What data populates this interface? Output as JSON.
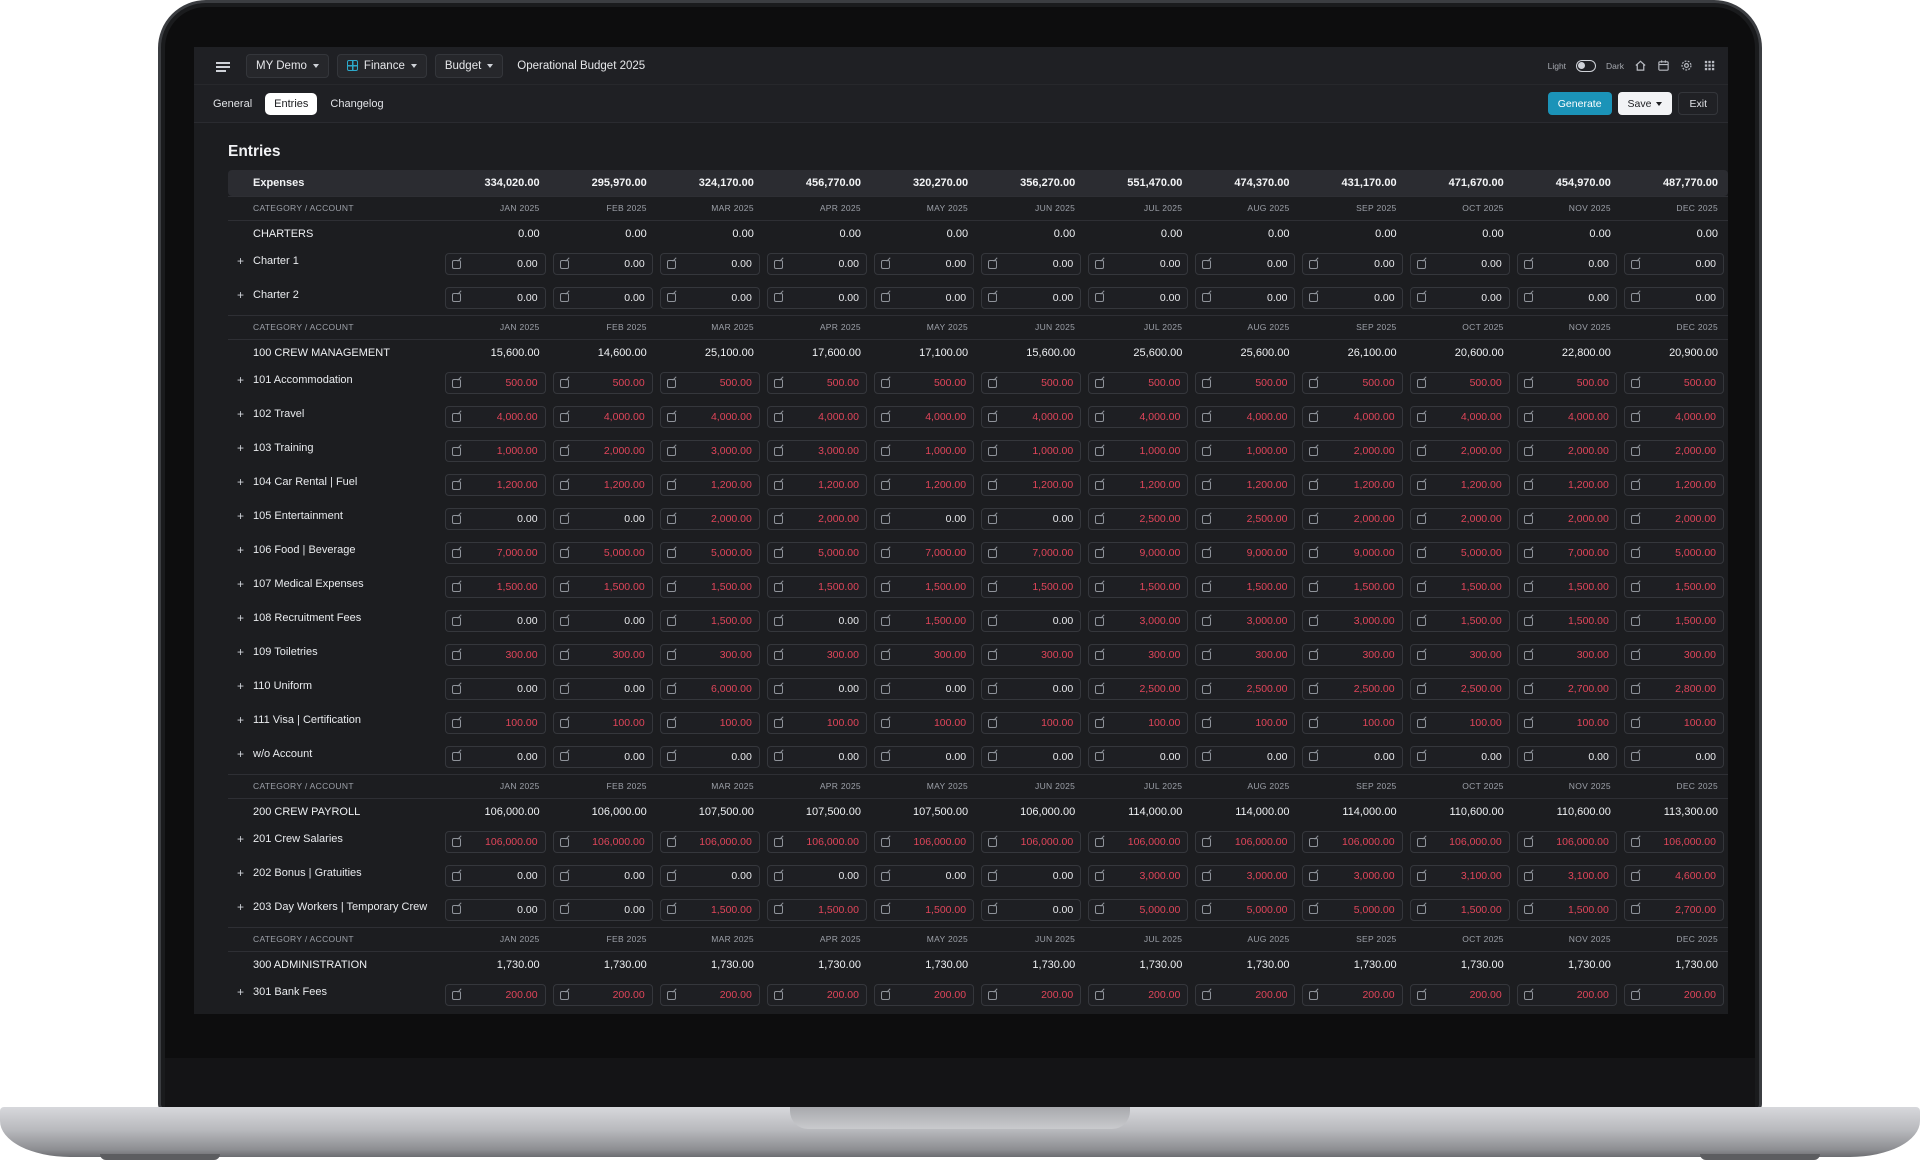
{
  "topbar": {
    "workspace": "MY Demo",
    "module": "Finance",
    "section": "Budget",
    "title": "Operational Budget 2025",
    "theme_light": "Light",
    "theme_dark": "Dark"
  },
  "tabs": [
    {
      "label": "General",
      "active": false
    },
    {
      "label": "Entries",
      "active": true
    },
    {
      "label": "Changelog",
      "active": false
    }
  ],
  "actions": {
    "generate": "Generate",
    "save": "Save",
    "exit": "Exit"
  },
  "page_title": "Entries",
  "expenses": {
    "label": "Expenses",
    "values": [
      "334,020.00",
      "295,970.00",
      "324,170.00",
      "456,770.00",
      "320,270.00",
      "356,270.00",
      "551,470.00",
      "474,370.00",
      "431,170.00",
      "471,670.00",
      "454,970.00",
      "487,770.00"
    ]
  },
  "header": {
    "label": "CATEGORY / ACCOUNT",
    "months": [
      "JAN 2025",
      "FEB 2025",
      "MAR 2025",
      "APR 2025",
      "MAY 2025",
      "JUN 2025",
      "JUL 2025",
      "AUG 2025",
      "SEP 2025",
      "OCT 2025",
      "NOV 2025",
      "DEC 2025"
    ]
  },
  "groups": [
    {
      "name": "CHARTERS",
      "totals": [
        "0.00",
        "0.00",
        "0.00",
        "0.00",
        "0.00",
        "0.00",
        "0.00",
        "0.00",
        "0.00",
        "0.00",
        "0.00",
        "0.00"
      ],
      "accounts": [
        {
          "name": "Charter 1",
          "values": [
            "0.00",
            "0.00",
            "0.00",
            "0.00",
            "0.00",
            "0.00",
            "0.00",
            "0.00",
            "0.00",
            "0.00",
            "0.00",
            "0.00"
          ]
        },
        {
          "name": "Charter 2",
          "values": [
            "0.00",
            "0.00",
            "0.00",
            "0.00",
            "0.00",
            "0.00",
            "0.00",
            "0.00",
            "0.00",
            "0.00",
            "0.00",
            "0.00"
          ]
        }
      ]
    },
    {
      "name": "100 CREW MANAGEMENT",
      "totals": [
        "15,600.00",
        "14,600.00",
        "25,100.00",
        "17,600.00",
        "17,100.00",
        "15,600.00",
        "25,600.00",
        "25,600.00",
        "26,100.00",
        "20,600.00",
        "22,800.00",
        "20,900.00"
      ],
      "accounts": [
        {
          "name": "101 Accommodation",
          "values": [
            "500.00",
            "500.00",
            "500.00",
            "500.00",
            "500.00",
            "500.00",
            "500.00",
            "500.00",
            "500.00",
            "500.00",
            "500.00",
            "500.00"
          ]
        },
        {
          "name": "102 Travel",
          "values": [
            "4,000.00",
            "4,000.00",
            "4,000.00",
            "4,000.00",
            "4,000.00",
            "4,000.00",
            "4,000.00",
            "4,000.00",
            "4,000.00",
            "4,000.00",
            "4,000.00",
            "4,000.00"
          ]
        },
        {
          "name": "103 Training",
          "values": [
            "1,000.00",
            "2,000.00",
            "3,000.00",
            "3,000.00",
            "1,000.00",
            "1,000.00",
            "1,000.00",
            "1,000.00",
            "2,000.00",
            "2,000.00",
            "2,000.00",
            "2,000.00"
          ]
        },
        {
          "name": "104 Car Rental | Fuel",
          "values": [
            "1,200.00",
            "1,200.00",
            "1,200.00",
            "1,200.00",
            "1,200.00",
            "1,200.00",
            "1,200.00",
            "1,200.00",
            "1,200.00",
            "1,200.00",
            "1,200.00",
            "1,200.00"
          ]
        },
        {
          "name": "105 Entertainment",
          "values": [
            "0.00",
            "0.00",
            "2,000.00",
            "2,000.00",
            "0.00",
            "0.00",
            "2,500.00",
            "2,500.00",
            "2,000.00",
            "2,000.00",
            "2,000.00",
            "2,000.00"
          ]
        },
        {
          "name": "106 Food | Beverage",
          "values": [
            "7,000.00",
            "5,000.00",
            "5,000.00",
            "5,000.00",
            "7,000.00",
            "7,000.00",
            "9,000.00",
            "9,000.00",
            "9,000.00",
            "5,000.00",
            "7,000.00",
            "5,000.00"
          ]
        },
        {
          "name": "107 Medical Expenses",
          "values": [
            "1,500.00",
            "1,500.00",
            "1,500.00",
            "1,500.00",
            "1,500.00",
            "1,500.00",
            "1,500.00",
            "1,500.00",
            "1,500.00",
            "1,500.00",
            "1,500.00",
            "1,500.00"
          ]
        },
        {
          "name": "108 Recruitment Fees",
          "values": [
            "0.00",
            "0.00",
            "1,500.00",
            "0.00",
            "1,500.00",
            "0.00",
            "3,000.00",
            "3,000.00",
            "3,000.00",
            "1,500.00",
            "1,500.00",
            "1,500.00"
          ]
        },
        {
          "name": "109 Toiletries",
          "values": [
            "300.00",
            "300.00",
            "300.00",
            "300.00",
            "300.00",
            "300.00",
            "300.00",
            "300.00",
            "300.00",
            "300.00",
            "300.00",
            "300.00"
          ]
        },
        {
          "name": "110 Uniform",
          "values": [
            "0.00",
            "0.00",
            "6,000.00",
            "0.00",
            "0.00",
            "0.00",
            "2,500.00",
            "2,500.00",
            "2,500.00",
            "2,500.00",
            "2,700.00",
            "2,800.00"
          ]
        },
        {
          "name": "111 Visa | Certification",
          "values": [
            "100.00",
            "100.00",
            "100.00",
            "100.00",
            "100.00",
            "100.00",
            "100.00",
            "100.00",
            "100.00",
            "100.00",
            "100.00",
            "100.00"
          ]
        },
        {
          "name": "w/o Account",
          "values": [
            "0.00",
            "0.00",
            "0.00",
            "0.00",
            "0.00",
            "0.00",
            "0.00",
            "0.00",
            "0.00",
            "0.00",
            "0.00",
            "0.00"
          ]
        }
      ]
    },
    {
      "name": "200 CREW PAYROLL",
      "totals": [
        "106,000.00",
        "106,000.00",
        "107,500.00",
        "107,500.00",
        "107,500.00",
        "106,000.00",
        "114,000.00",
        "114,000.00",
        "114,000.00",
        "110,600.00",
        "110,600.00",
        "113,300.00"
      ],
      "accounts": [
        {
          "name": "201 Crew Salaries",
          "values": [
            "106,000.00",
            "106,000.00",
            "106,000.00",
            "106,000.00",
            "106,000.00",
            "106,000.00",
            "106,000.00",
            "106,000.00",
            "106,000.00",
            "106,000.00",
            "106,000.00",
            "106,000.00"
          ]
        },
        {
          "name": "202 Bonus | Gratuities",
          "values": [
            "0.00",
            "0.00",
            "0.00",
            "0.00",
            "0.00",
            "0.00",
            "3,000.00",
            "3,000.00",
            "3,000.00",
            "3,100.00",
            "3,100.00",
            "4,600.00"
          ]
        },
        {
          "name": "203 Day Workers | Temporary Crew",
          "values": [
            "0.00",
            "0.00",
            "1,500.00",
            "1,500.00",
            "1,500.00",
            "0.00",
            "5,000.00",
            "5,000.00",
            "5,000.00",
            "1,500.00",
            "1,500.00",
            "2,700.00"
          ]
        }
      ]
    },
    {
      "name": "300 ADMINISTRATION",
      "totals": [
        "1,730.00",
        "1,730.00",
        "1,730.00",
        "1,730.00",
        "1,730.00",
        "1,730.00",
        "1,730.00",
        "1,730.00",
        "1,730.00",
        "1,730.00",
        "1,730.00",
        "1,730.00"
      ],
      "accounts": [
        {
          "name": "301 Bank Fees",
          "values": [
            "200.00",
            "200.00",
            "200.00",
            "200.00",
            "200.00",
            "200.00",
            "200.00",
            "200.00",
            "200.00",
            "200.00",
            "200.00",
            "200.00"
          ]
        }
      ]
    }
  ],
  "colors": {
    "accent": "#1b93b8",
    "negative": "#e0455a",
    "background": "#1c1d20"
  }
}
